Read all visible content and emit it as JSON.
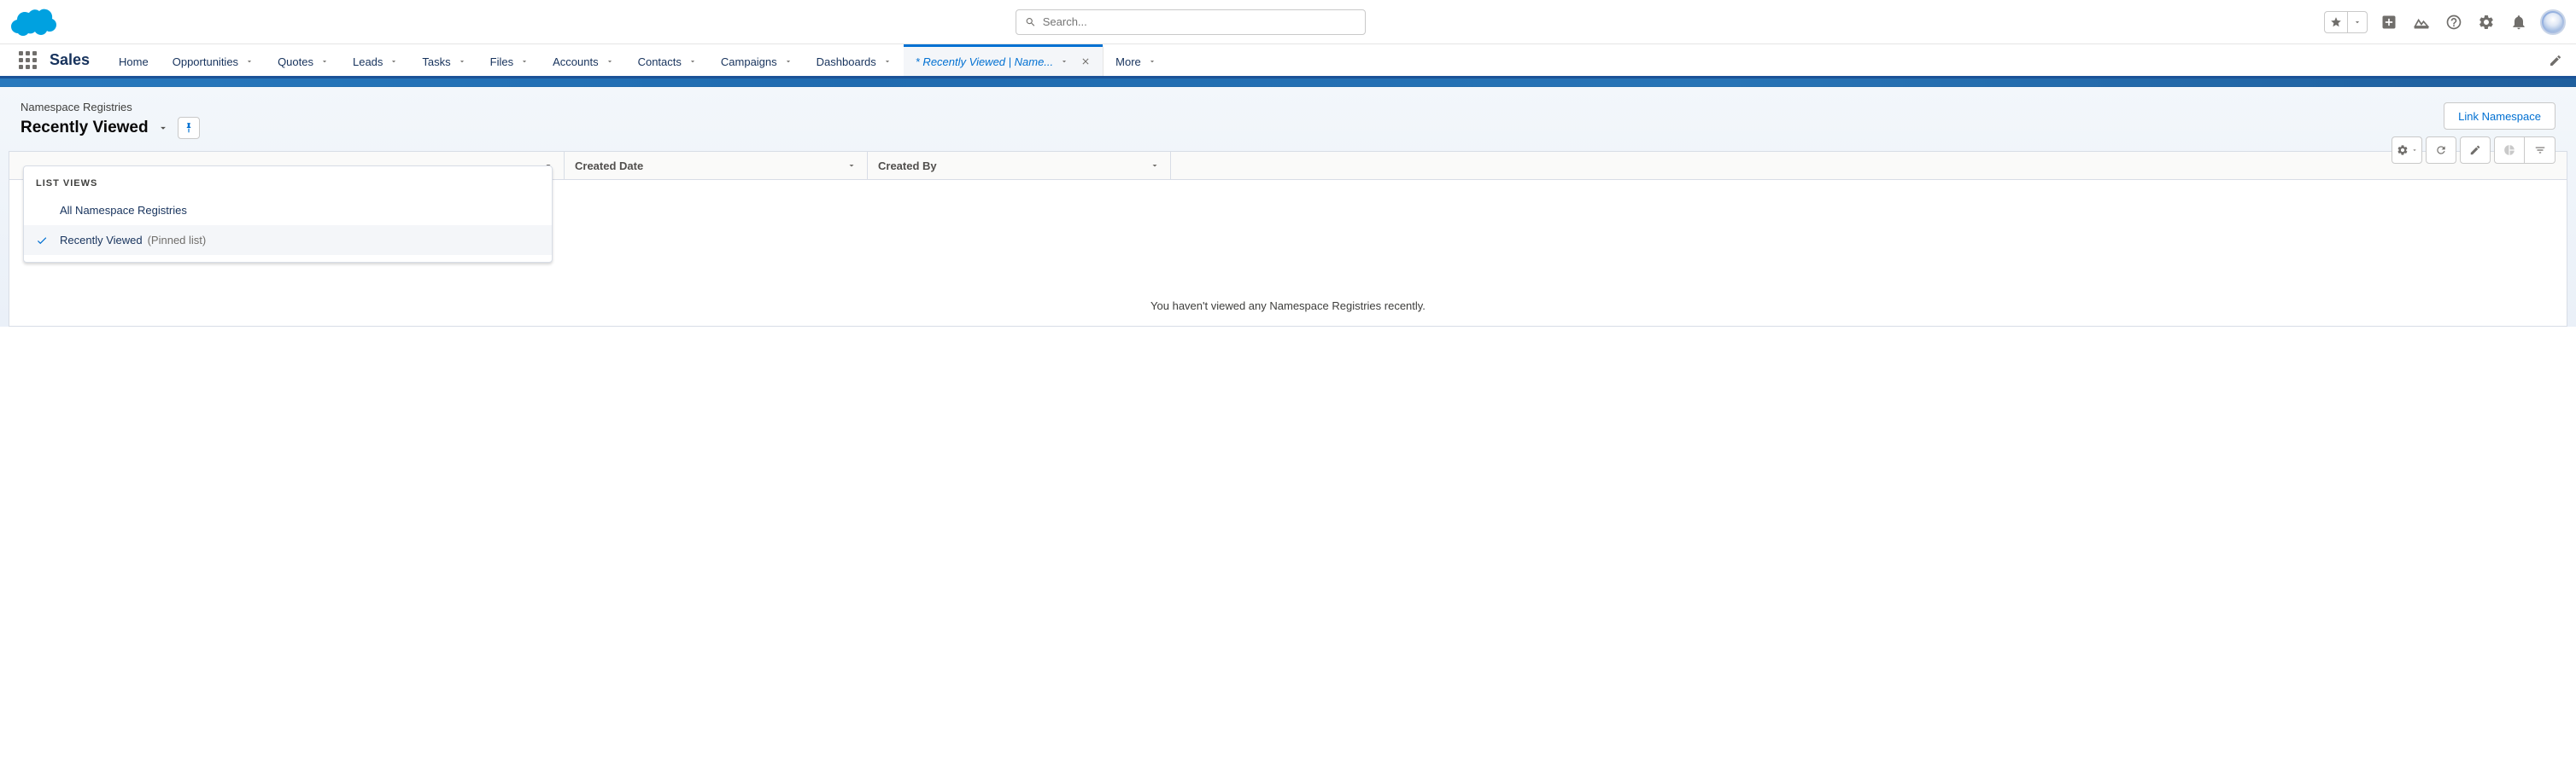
{
  "header": {
    "search_placeholder": "Search..."
  },
  "nav": {
    "app_name": "Sales",
    "items": [
      "Home",
      "Opportunities",
      "Quotes",
      "Leads",
      "Tasks",
      "Files",
      "Accounts",
      "Contacts",
      "Campaigns",
      "Dashboards"
    ],
    "active_tab": "* Recently Viewed | Name...",
    "more": "More"
  },
  "page": {
    "object_label": "Namespace Registries",
    "view_title": "Recently Viewed",
    "action_button": "Link Namespace"
  },
  "dropdown": {
    "header": "LIST VIEWS",
    "items": [
      {
        "label": "All Namespace Registries",
        "selected": false,
        "suffix": ""
      },
      {
        "label": "Recently Viewed",
        "selected": true,
        "suffix": "(Pinned list)"
      }
    ]
  },
  "table": {
    "columns": [
      "Created Date",
      "Created By"
    ],
    "empty_message": "You haven't viewed any Namespace Registries recently."
  }
}
